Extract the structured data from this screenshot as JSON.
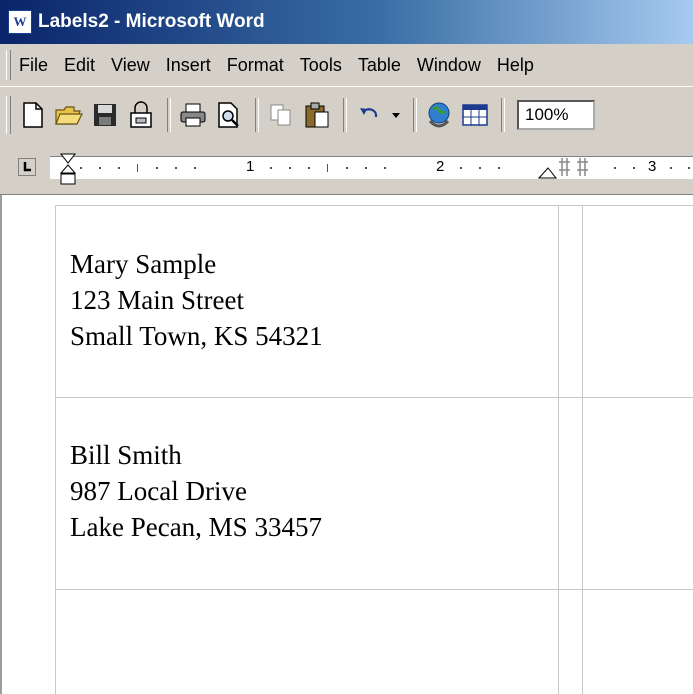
{
  "window": {
    "title": "Labels2 - Microsoft Word",
    "app_icon_glyph": "W"
  },
  "menu": {
    "items": [
      {
        "label": "File",
        "accel": "F"
      },
      {
        "label": "Edit",
        "accel": "E"
      },
      {
        "label": "View",
        "accel": "V"
      },
      {
        "label": "Insert",
        "accel": "I"
      },
      {
        "label": "Format",
        "accel": "o"
      },
      {
        "label": "Tools",
        "accel": "T"
      },
      {
        "label": "Table",
        "accel": "a"
      },
      {
        "label": "Window",
        "accel": "W"
      },
      {
        "label": "Help",
        "accel": "H"
      }
    ]
  },
  "toolbar": {
    "zoom": "100%",
    "icons": [
      "new-document-icon",
      "open-folder-icon",
      "save-icon",
      "permission-icon",
      "print-icon",
      "print-preview-icon",
      "copy-icon",
      "paste-icon",
      "undo-icon",
      "web-icon",
      "table-icon"
    ]
  },
  "ruler": {
    "numbers": [
      "1",
      "2",
      "3"
    ]
  },
  "document": {
    "labels": [
      {
        "name": "Mary Sample",
        "street": "123 Main Street",
        "city": "Small Town, KS 54321"
      },
      {
        "name": "Bill Smith",
        "street": "987 Local Drive",
        "city": "Lake Pecan, MS 33457"
      }
    ]
  },
  "colors": {
    "titlebar_start": "#0a246a",
    "titlebar_end": "#a6caf0",
    "chrome": "#d4d0c8"
  }
}
